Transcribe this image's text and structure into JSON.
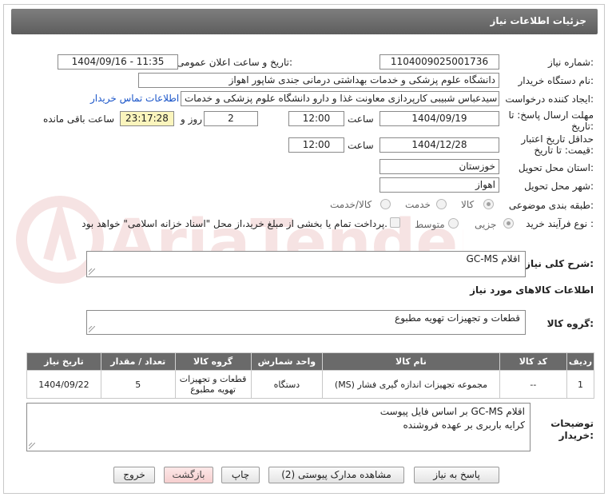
{
  "header": {
    "title": "جزئیات اطلاعات نیاز"
  },
  "fields": {
    "need_number_label": "شماره نیاز:",
    "need_number": "1104009025001736",
    "announce_label": "تاریخ و ساعت اعلان عمومی:",
    "announce_value": "1404/09/16 - 11:35",
    "buyer_org_label": "نام دستگاه خریدار:",
    "buyer_org": "دانشگاه علوم پزشکی و خدمات بهداشتی درمانی جندی شاپور اهواز",
    "requester_label": "ایجاد کننده درخواست:",
    "requester": "سیدعباس شبیبی کارپردازی معاونت غذا و دارو دانشگاه علوم پزشکی و خدمات",
    "contact_link": "اطلاعات تماس خریدار",
    "deadline_label_1": "مهلت ارسال پاسخ: تا",
    "deadline_label_2": "تاریخ:",
    "deadline_date": "1404/09/19",
    "time_label": "ساعت",
    "deadline_time": "12:00",
    "days_value": "2",
    "days_label": "روز و",
    "remaining_time": "23:17:28",
    "remaining_label": "ساعت باقی مانده",
    "validity_label_1": "حداقل تاریخ اعتبار",
    "validity_label_2": "قیمت: تا تاریخ:",
    "validity_date": "1404/12/28",
    "validity_time": "12:00",
    "province_label": "استان محل تحویل:",
    "province": "خوزستان",
    "city_label": "شهر محل تحویل:",
    "city": "اهواز",
    "category_label": "طبقه بندی موضوعی:",
    "category_options": [
      "کالا",
      "خدمت",
      "کالا/خدمت"
    ],
    "category_selected": "کالا",
    "process_label": "نوع فرآیند خرید :",
    "process_options": [
      "جزیی",
      "متوسط"
    ],
    "process_selected": "جزیی",
    "payment_note": "پرداخت تمام یا بخشی از مبلغ خرید،از محل \"اسناد خزانه اسلامی\" خواهد بود."
  },
  "description": {
    "label": "شرح کلی نیاز:",
    "value": "اقلام GC-MS"
  },
  "goods_section": {
    "title": "اطلاعات کالاهای مورد نیاز"
  },
  "goods_group": {
    "label": "گروه کالا:",
    "value": "قطعات و تجهیزات تهویه مطبوع"
  },
  "table": {
    "headers": [
      "ردیف",
      "کد کالا",
      "نام کالا",
      "واحد شمارش",
      "گروه کالا",
      "تعداد / مقدار",
      "تاریخ نیاز"
    ],
    "rows": [
      [
        "1",
        "--",
        "مجموعه تجهیزات اندازه گیری فشار (MS)",
        "دستگاه",
        "قطعات و تجهیزات تهویه مطبوع",
        "5",
        "1404/09/22"
      ]
    ]
  },
  "buyer_notes": {
    "label_1": "توضیحات",
    "label_2": "خریدار:",
    "line_1": "اقلام GC-MS بر اساس فایل پیوست",
    "line_2": "کرایه باربری بر عهده فروشنده"
  },
  "buttons": {
    "reply": "پاسخ به نیاز",
    "attachments": "مشاهده مدارک پیوستی (2)",
    "print": "چاپ",
    "back": "بازگشت",
    "exit": "خروج"
  },
  "watermark": {
    "text": "AriaTender.net"
  },
  "colors": {
    "header_bg": "#6e6e6e",
    "link": "#1a55c9",
    "remaining_bg": "#fbf5bd",
    "pink_button": "#f6cfcf"
  }
}
